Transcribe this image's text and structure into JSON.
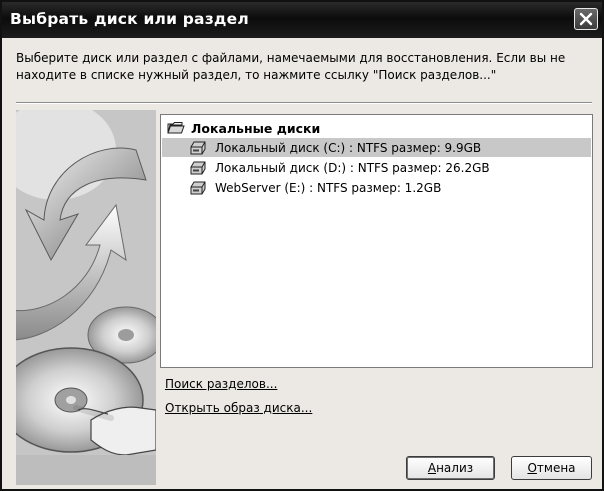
{
  "window": {
    "title": "Выбрать диск или раздел"
  },
  "description": "Выберите диск или раздел с файлами, намечаемыми для восстановления. Если вы не находите в списке нужный раздел, то нажмите ссылку \"Поиск разделов...\"",
  "tree": {
    "root_label": "Локальные диски",
    "items": [
      {
        "label": "Локальный диск (C:) : NTFS размер: 9.9GB",
        "selected": true
      },
      {
        "label": "Локальный диск (D:) : NTFS размер: 26.2GB",
        "selected": false
      },
      {
        "label": "WebServer (E:) : NTFS размер: 1.2GB",
        "selected": false
      }
    ]
  },
  "links": {
    "search_partitions": "Поиск разделов...",
    "open_disk_image": "Открыть образ диска..."
  },
  "buttons": {
    "analyze_first": "А",
    "analyze_rest": "нализ",
    "cancel_first": "О",
    "cancel_rest": "тмена"
  },
  "icons": {
    "close": "close-icon",
    "folder": "folder-open-icon",
    "disk": "hard-disk-icon"
  }
}
